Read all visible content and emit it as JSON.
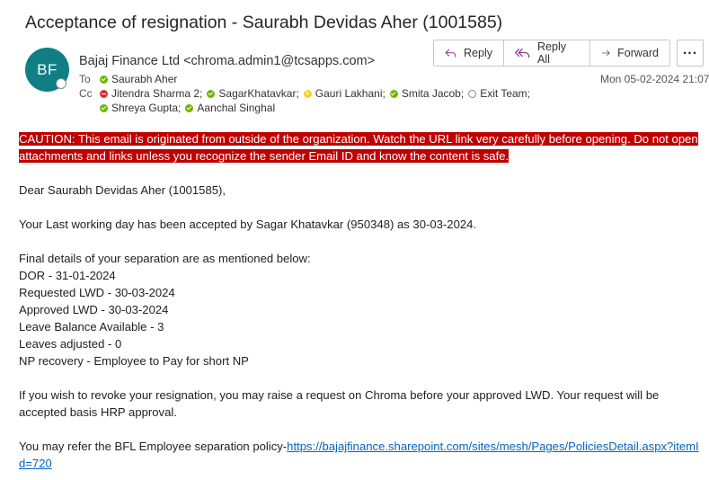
{
  "email": {
    "subject": "Acceptance of resignation - Saurabh Devidas Aher (1001585)",
    "avatar_initials": "BF",
    "sender": "Bajaj Finance Ltd <chroma.admin1@tcsapps.com>",
    "to_label": "To",
    "to": [
      {
        "name": "Saurabh Aher",
        "status": "available"
      }
    ],
    "cc_label": "Cc",
    "cc_line1": [
      {
        "name": "Jitendra Sharma 2;",
        "status": "busy"
      },
      {
        "name": "SagarKhatavkar;",
        "status": "available"
      },
      {
        "name": "Gauri Lakhani;",
        "status": "away"
      },
      {
        "name": "Smita Jacob;",
        "status": "available"
      },
      {
        "name": "Exit Team;",
        "status": "offline"
      }
    ],
    "cc_line2": [
      {
        "name": "Shreya Gupta;",
        "status": "available"
      },
      {
        "name": "Aanchal Singhal",
        "status": "available"
      }
    ],
    "date": "Mon 05-02-2024 21:07"
  },
  "actions": {
    "reply": "Reply",
    "reply_all": "Reply All",
    "forward": "Forward",
    "more": "..."
  },
  "body": {
    "caution": "CAUTION: This email is originated from outside of the organization. Watch the URL link very carefully before opening. Do not open attachments and links unless you recognize the sender Email ID and know the content is safe.",
    "greeting": "Dear Saurabh Devidas Aher (1001585),",
    "lwd_accepted": "Your Last working day has been accepted by Sagar Khatavkar (950348) as 30-03-2024.",
    "details_intro": "Final details of your separation are as mentioned below:",
    "details": [
      "DOR - 31-01-2024",
      "Requested LWD - 30-03-2024",
      "Approved LWD - 30-03-2024",
      "Leave Balance Available - 3",
      "Leaves adjusted - 0",
      "NP recovery - Employee to Pay for short NP"
    ],
    "revoke_note": "If you wish to revoke your resignation, you may raise a request on Chroma before your approved LWD. Your request will be accepted basis HRP approval.",
    "policy_prefix": "You may refer the BFL Employee separation policy-",
    "policy_link": "https://bajajfinance.sharepoint.com/sites/mesh/Pages/PoliciesDetail.aspx?itemId=720"
  },
  "colors": {
    "avatar": "#0f7f84",
    "caution_bg": "#c00000",
    "link": "#0563c1",
    "presence_available": "#6bb700",
    "presence_busy": "#d13438",
    "presence_away": "#f8d22a"
  },
  "icons": {
    "reply": "reply-arrow-icon",
    "reply_all": "reply-all-arrow-icon",
    "forward": "forward-arrow-icon",
    "more": "more-horizontal-icon"
  }
}
